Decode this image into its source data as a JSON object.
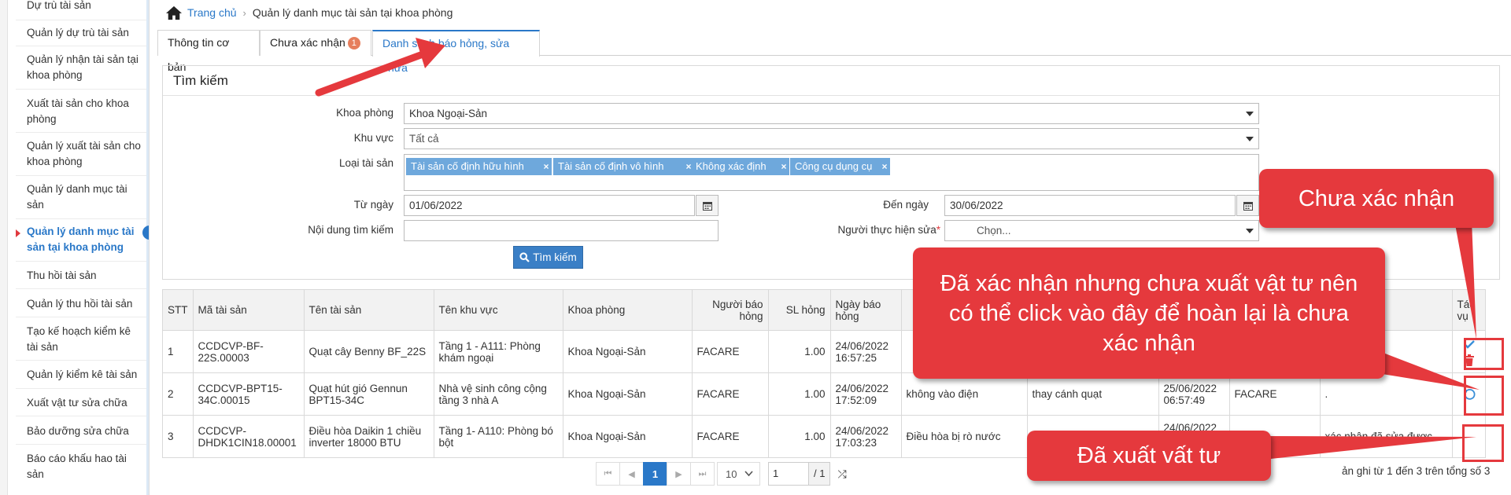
{
  "sidebar": {
    "items": [
      {
        "label": "Dự trù tài sản"
      },
      {
        "label": "Quản lý dự trù tài sản"
      },
      {
        "label": "Quản lý nhận tài sản tại khoa phòng"
      },
      {
        "label": "Xuất tài sản cho khoa phòng"
      },
      {
        "label": "Quản lý xuất tài sản cho khoa phòng"
      },
      {
        "label": "Quản lý danh mục tài sản"
      },
      {
        "label": "Quản lý danh mục tài sản tại khoa phòng"
      },
      {
        "label": "Thu hồi tài sản"
      },
      {
        "label": "Quản lý thu hồi tài sản"
      },
      {
        "label": "Tạo kế hoạch kiểm kê tài sản"
      },
      {
        "label": "Quản lý kiểm kê tài sản"
      },
      {
        "label": "Xuất vật tư sửa chữa"
      },
      {
        "label": "Bảo dưỡng sửa chữa"
      },
      {
        "label": "Báo cáo khấu hao tài sản"
      }
    ],
    "active_index": 6
  },
  "breadcrumb": {
    "home": "Trang chủ",
    "current": "Quản lý danh mục tài sản tại khoa phòng"
  },
  "tabs": [
    {
      "label": "Thông tin cơ bản"
    },
    {
      "label": "Chưa xác nhận",
      "badge": "1"
    },
    {
      "label": "Danh sách báo hỏng, sửa chữa",
      "active": true
    }
  ],
  "search": {
    "title": "Tìm kiếm",
    "department_label": "Khoa phòng",
    "department_value": "Khoa Ngoại-Sản",
    "area_label": "Khu vực",
    "area_value": "Tất cả",
    "asset_type_label": "Loại tài sản",
    "asset_types": [
      "Tài sản cố định hữu hình",
      "Tài sản cố định vô hình",
      "Không xác định",
      "Công cụ dụng cụ"
    ],
    "from_label": "Từ ngày",
    "from_value": "01/06/2022",
    "to_label": "Đến ngày",
    "to_value": "30/06/2022",
    "content_label": "Nội dung tìm kiếm",
    "content_value": "",
    "repairer_label": "Người thực hiện sửa",
    "repairer_required": "*",
    "repairer_placeholder": "Chọn...",
    "button_label": "Tìm kiếm"
  },
  "table": {
    "headers": {
      "stt": "STT",
      "code": "Mã tài sản",
      "name": "Tên tài sản",
      "area": "Tên khu vực",
      "dept": "Khoa phòng",
      "reporter": "Người báo hỏng",
      "qty": "SL hỏng",
      "report_date": "Ngày báo hỏng",
      "actions": "Tác vụ"
    },
    "rows": [
      {
        "stt": "1",
        "code": "CCDCVP-BF-22S.00003",
        "name": "Quạt cây Benny BF_22S",
        "area": "Tầng 1 - A111: Phòng khám ngoại",
        "dept": "Khoa Ngoại-Sản",
        "reporter": "FACARE",
        "qty": "1.00",
        "report_date": "24/06/2022 16:57:25",
        "reason": "",
        "fix": "",
        "confirm_date": "",
        "confirmer": "",
        "note": ""
      },
      {
        "stt": "2",
        "code": "CCDCVP-BPT15-34C.00015",
        "name": "Quạt hút gió Gennun BPT15-34C",
        "area": "Nhà vệ sinh công cộng tầng 3 nhà A",
        "dept": "Khoa Ngoại-Sản",
        "reporter": "FACARE",
        "qty": "1.00",
        "report_date": "24/06/2022 17:52:09",
        "reason": "không vào điện",
        "fix": "thay cánh quạt",
        "confirm_date": "25/06/2022 06:57:49",
        "confirmer": "FACARE",
        "note": "."
      },
      {
        "stt": "3",
        "code": "CCDCVP-DHDK1CIN18.00001",
        "name": "Điều hòa Daikin 1 chiều inverter 18000 BTU",
        "area": "Tầng 1- A110: Phòng bó bột",
        "dept": "Khoa Ngoại-Sản",
        "reporter": "FACARE",
        "qty": "1.00",
        "report_date": "24/06/2022 17:03:23",
        "reason": "Điều hòa bị rò nước",
        "fix": "",
        "confirm_date": "24/06/2022",
        "confirmer": "",
        "note": "xác nhận đã sửa được"
      }
    ]
  },
  "pager": {
    "current": "1",
    "page_size": "10",
    "page_input": "1",
    "total_pages": "/ 1",
    "records": "ản ghi từ 1 đến 3 trên tổng số 3"
  },
  "callouts": {
    "unconfirmed": "Chưa xác nhận",
    "confirmed": "Đã xác nhận nhưng chưa xuất vật tư nên có thể click vào đây để hoàn lại là chưa xác nhận",
    "exported": "Đã xuất vất tư"
  },
  "colors": {
    "accent": "#2a78c8",
    "callout": "#e5393d",
    "badge": "#e67e5c",
    "tag": "#6ea8dc"
  }
}
